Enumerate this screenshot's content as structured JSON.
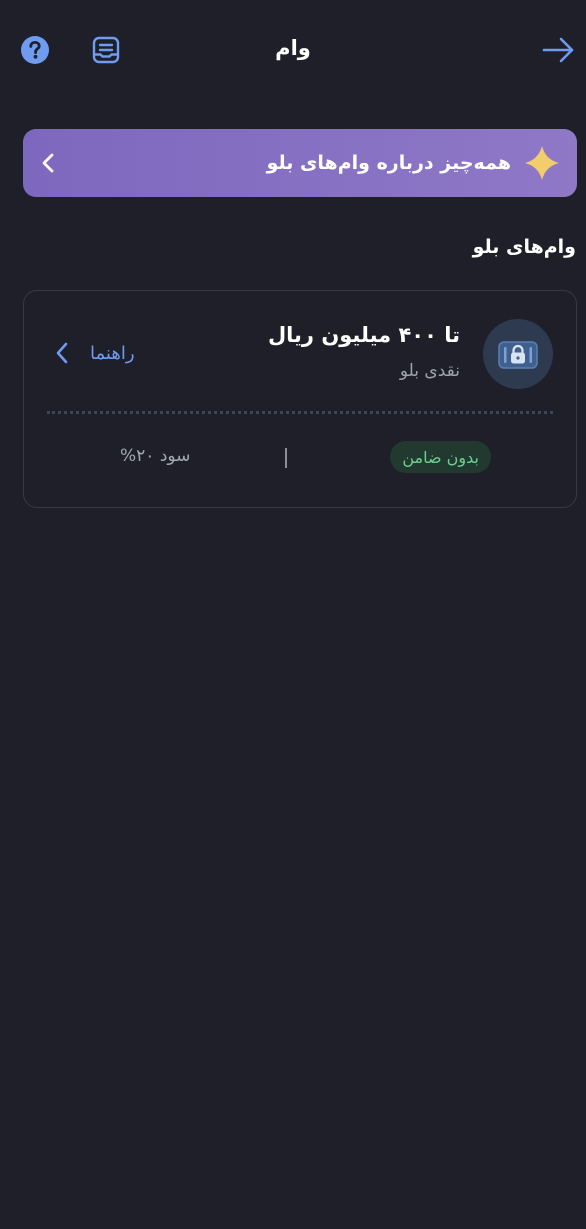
{
  "header": {
    "title": "وام",
    "help_icon": "question-circle-icon",
    "notes_icon": "document-list-icon",
    "back_icon": "arrow-right-icon",
    "accent_color": "#6f9cf0"
  },
  "banner": {
    "text": "همه‌چیز درباره وام‌های بلو",
    "star_icon": "sparkle-star-icon",
    "chevron_icon": "chevron-left-icon",
    "gradient": [
      "#7d68bf",
      "#8f78c6"
    ],
    "star_color": "#f3cd6b"
  },
  "section": {
    "title": "وام‌های بلو"
  },
  "loans": [
    {
      "amount": "تا ۴۰۰ میلیون ریال",
      "type": "نقدی بلو",
      "guide_label": "راهنما",
      "tag": "بدون ضامن",
      "profit": "سود ۲۰%",
      "icon": "lock-card-icon",
      "tag_color": "#6ed08f"
    }
  ]
}
